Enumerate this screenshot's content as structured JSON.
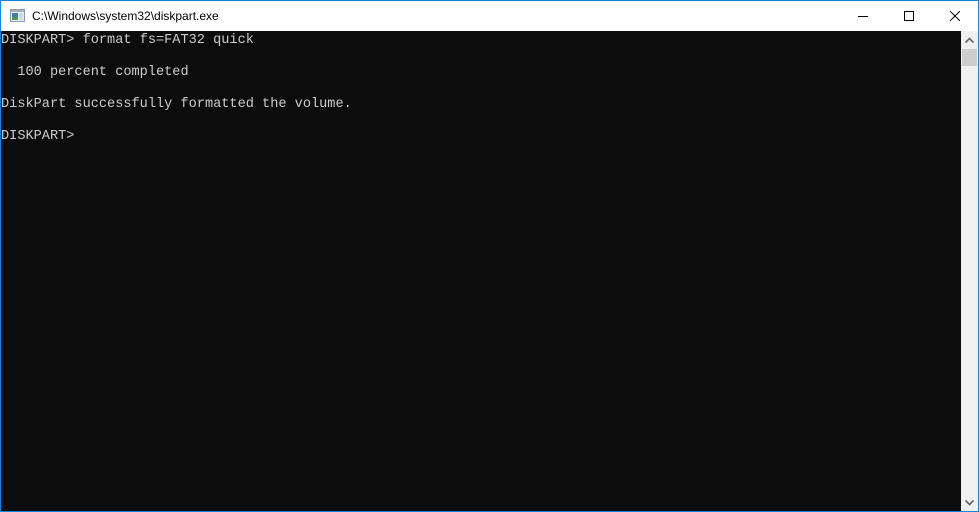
{
  "window": {
    "title": "C:\\Windows\\system32\\diskpart.exe",
    "icon": "console-window-icon",
    "controls": {
      "minimize": "minimize-icon",
      "maximize": "maximize-icon",
      "close": "close-icon"
    }
  },
  "console": {
    "lines": [
      "DISKPART> format fs=FAT32 quick",
      "",
      "  100 percent completed",
      "",
      "DiskPart successfully formatted the volume.",
      "",
      "DISKPART> "
    ],
    "text_color": "#cccccc",
    "background": "#0c0c0c"
  },
  "scrollbar": {
    "up_icon": "chevron-up-icon",
    "down_icon": "chevron-down-icon"
  },
  "colors": {
    "border": "#1883d7"
  }
}
